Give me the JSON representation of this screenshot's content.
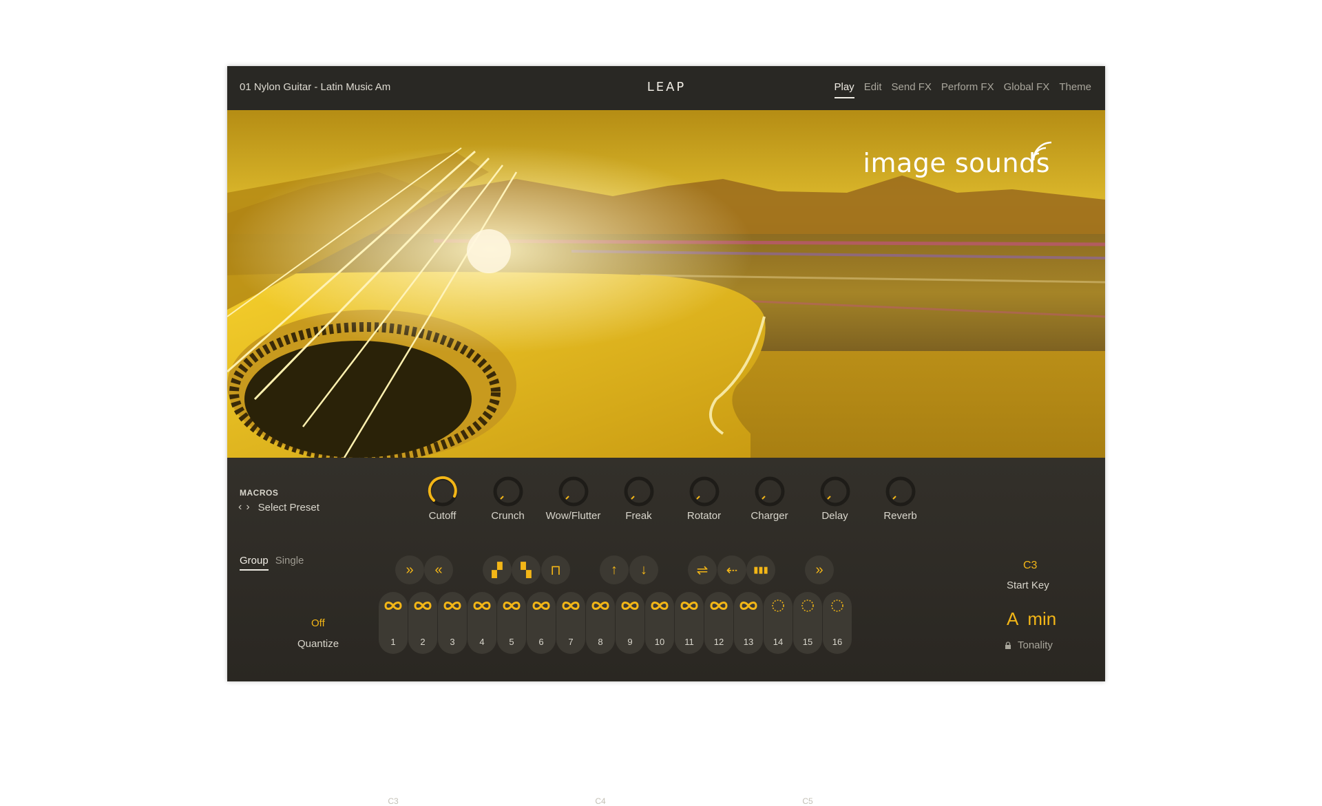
{
  "header": {
    "preset_name": "01 Nylon Guitar - Latin Music Am",
    "logo": "LEAP",
    "tabs": [
      "Play",
      "Edit",
      "Send FX",
      "Perform FX",
      "Global FX",
      "Theme"
    ],
    "active_tab": "Play"
  },
  "banner": {
    "brand": "image sounds",
    "brand_icon": "sound-waves-icon"
  },
  "macros": {
    "title": "MACROS",
    "select_preset": "Select Preset",
    "knobs": [
      {
        "label": "Cutoff",
        "value": 0.85
      },
      {
        "label": "Crunch",
        "value": 0.0
      },
      {
        "label": "Wow/Flutter",
        "value": 0.0
      },
      {
        "label": "Freak",
        "value": 0.0
      },
      {
        "label": "Rotator",
        "value": 0.0
      },
      {
        "label": "Charger",
        "value": 0.0
      },
      {
        "label": "Delay",
        "value": 0.0
      },
      {
        "label": "Reverb",
        "value": 0.0
      }
    ]
  },
  "mode_tabs": [
    "Group",
    "Single"
  ],
  "actions": [
    {
      "icon": "fast-forward-icon",
      "glyph": "»"
    },
    {
      "icon": "rewind-icon",
      "glyph": "«"
    },
    {
      "icon": "pattern-a-icon",
      "glyph": "▞"
    },
    {
      "icon": "pattern-b-icon",
      "glyph": "▚"
    },
    {
      "icon": "waveform-icon",
      "glyph": "⊓"
    },
    {
      "icon": "arrow-up-icon",
      "glyph": "↑"
    },
    {
      "icon": "arrow-down-icon",
      "glyph": "↓"
    },
    {
      "icon": "swap-icon",
      "glyph": "⇌"
    },
    {
      "icon": "dotted-arrow-icon",
      "glyph": "⇠"
    },
    {
      "icon": "bars-icon",
      "glyph": "▮▮▮"
    },
    {
      "icon": "fast-forward-icon",
      "glyph": "»"
    }
  ],
  "pads": [
    {
      "num": "1",
      "type": "loop"
    },
    {
      "num": "2",
      "type": "loop"
    },
    {
      "num": "3",
      "type": "loop"
    },
    {
      "num": "4",
      "type": "loop"
    },
    {
      "num": "5",
      "type": "loop"
    },
    {
      "num": "6",
      "type": "loop"
    },
    {
      "num": "7",
      "type": "loop"
    },
    {
      "num": "8",
      "type": "loop"
    },
    {
      "num": "9",
      "type": "loop"
    },
    {
      "num": "10",
      "type": "loop"
    },
    {
      "num": "11",
      "type": "loop"
    },
    {
      "num": "12",
      "type": "loop"
    },
    {
      "num": "13",
      "type": "loop"
    },
    {
      "num": "14",
      "type": "oneshot"
    },
    {
      "num": "15",
      "type": "oneshot"
    },
    {
      "num": "16",
      "type": "oneshot"
    }
  ],
  "note_labels": {
    "c3": "C3",
    "c4": "C4",
    "c5": "C5"
  },
  "quantize": {
    "value": "Off",
    "label": "Quantize"
  },
  "start_key": {
    "value": "C3",
    "label": "Start Key"
  },
  "tonality": {
    "value": "A  min",
    "label": "Tonality"
  },
  "colors": {
    "accent": "#f3b617",
    "background": "#2a2823"
  }
}
